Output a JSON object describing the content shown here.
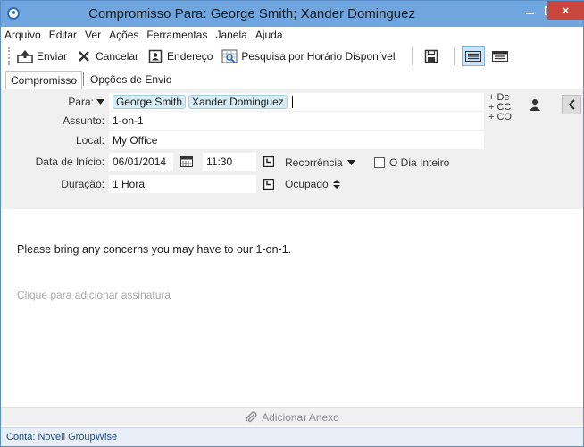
{
  "window": {
    "title": "Compromisso Para: George Smith; Xander Dominguez",
    "close_label": "×"
  },
  "menubar": [
    "Arquivo",
    "Editar",
    "Ver",
    "Ações",
    "Ferramentas",
    "Janela",
    "Ajuda"
  ],
  "toolbar": {
    "send_label": "Enviar",
    "cancel_label": "Cancelar",
    "address_label": "Endereço",
    "search_label": "Pesquisa por Horário Disponível"
  },
  "tabs": [
    "Compromisso",
    "Opções de Envio"
  ],
  "form": {
    "to_label": "Para:",
    "recipients": [
      "George Smith",
      "Xander Dominguez"
    ],
    "subject_label": "Assunto:",
    "subject_value": "1-on-1",
    "location_label": "Local:",
    "location_value": "My Office",
    "start_label": "Data de Início:",
    "start_date": "06/01/2014",
    "start_time": "11:30",
    "recurrence_label": "Recorrência",
    "all_day_label": "O Dia Inteiro",
    "duration_label": "Duração:",
    "duration_value": "1 Hora",
    "busy_label": "Ocupado",
    "from_link": "+ De",
    "cc_link": "+ CC",
    "bc_link": "+ CO"
  },
  "body": {
    "message": "Please bring any concerns you may have to our 1-on-1.",
    "signature_placeholder": "Clique para adicionar assinatura"
  },
  "attach_label": "Adicionar Anexo",
  "status": "Conta: Novell GroupWise",
  "colors": {
    "titlebar": "#6fa6df",
    "close": "#c9463d",
    "chip": "#d6ecf4",
    "form_bg": "#f0f0f0"
  }
}
